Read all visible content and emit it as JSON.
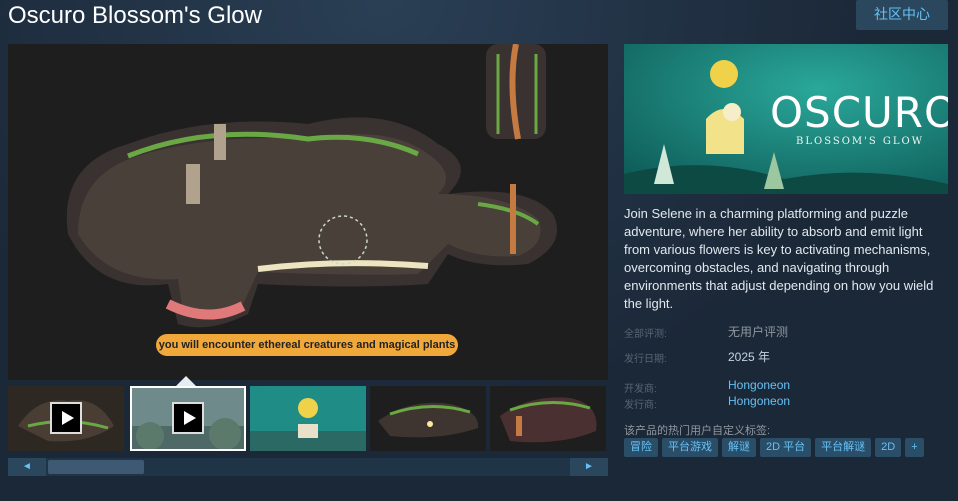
{
  "app": {
    "title": "Oscuro Blossom's Glow",
    "community_button": "社区中心"
  },
  "media": {
    "caption": "you will encounter ethereal creatures and magical plants",
    "thumbnails": [
      {
        "type": "video",
        "selected": false
      },
      {
        "type": "video",
        "selected": true
      },
      {
        "type": "image",
        "selected": false
      },
      {
        "type": "image",
        "selected": false
      },
      {
        "type": "image",
        "selected": false
      }
    ],
    "scroll_left": "◄",
    "scroll_right": "►"
  },
  "capsule": {
    "logo_text": "OSCURO",
    "logo_sub": "BLOSSOM'S GLOW"
  },
  "description": "Join Selene in a charming platforming and puzzle adventure, where her ability to absorb and emit light from various flowers is key to activating mechanisms, overcoming obstacles, and navigating through environments that adjust depending on how you wield the light.",
  "meta": {
    "reviews_label": "全部评测:",
    "reviews_value": "无用户评测",
    "release_label": "发行日期:",
    "release_value": "2025 年",
    "developer_label": "开发商:",
    "developer_value": "Hongoneon",
    "publisher_label": "发行商:",
    "publisher_value": "Hongoneon"
  },
  "tags": {
    "title": "该产品的热门用户自定义标签:",
    "items": [
      "冒险",
      "平台游戏",
      "解谜",
      "2D 平台",
      "平台解谜",
      "2D",
      "+"
    ]
  },
  "colors": {
    "background": "#1b2838",
    "link": "#66c0f4",
    "tag_bg": "#2a4d68",
    "caption_pill": "#f0a83a"
  }
}
